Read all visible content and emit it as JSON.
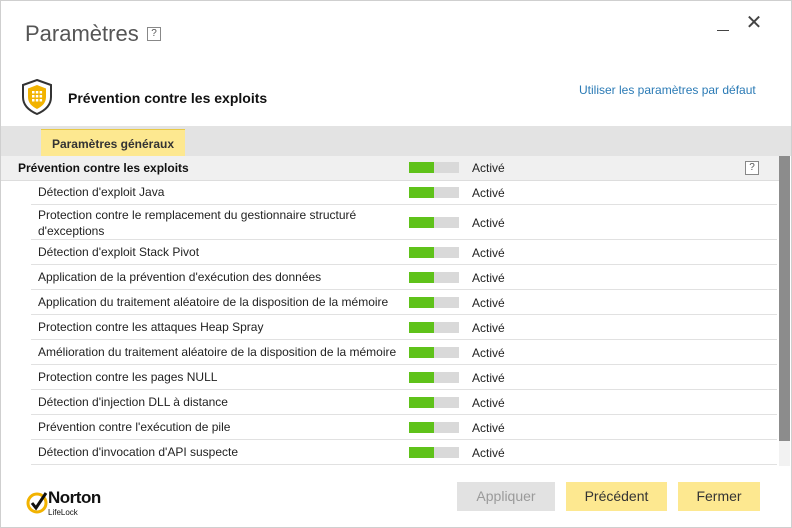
{
  "window": {
    "title": "Paramètres",
    "help": "?",
    "close_glyph": "✕"
  },
  "section": {
    "title": "Prévention contre les exploits",
    "defaults_link": "Utiliser les paramètres par défaut"
  },
  "tabs": [
    {
      "label": "Paramètres généraux",
      "active": true
    }
  ],
  "main_row": {
    "label": "Prévention contre les exploits",
    "status": "Activé",
    "toggle_level": 0.5,
    "help": "?"
  },
  "rows": [
    {
      "label": "Détection d'exploit Java",
      "status": "Activé",
      "toggle_level": 0.5
    },
    {
      "label": "Protection contre le remplacement du gestionnaire structuré d'exceptions",
      "status": "Activé",
      "toggle_level": 0.5
    },
    {
      "label": "Détection d'exploit Stack Pivot",
      "status": "Activé",
      "toggle_level": 0.5
    },
    {
      "label": "Application de la prévention d'exécution des données",
      "status": "Activé",
      "toggle_level": 0.5
    },
    {
      "label": "Application du traitement aléatoire de la disposition de la mémoire",
      "status": "Activé",
      "toggle_level": 0.5
    },
    {
      "label": "Protection contre les attaques Heap Spray",
      "status": "Activé",
      "toggle_level": 0.5
    },
    {
      "label": "Amélioration du traitement aléatoire de la disposition de la mémoire",
      "status": "Activé",
      "toggle_level": 0.5
    },
    {
      "label": "Protection contre les pages NULL",
      "status": "Activé",
      "toggle_level": 0.5
    },
    {
      "label": "Détection d'injection DLL à distance",
      "status": "Activé",
      "toggle_level": 0.5
    },
    {
      "label": "Prévention contre l'exécution de pile",
      "status": "Activé",
      "toggle_level": 0.5
    },
    {
      "label": "Détection d'invocation d'API suspecte",
      "status": "Activé",
      "toggle_level": 0.5
    }
  ],
  "footer": {
    "logo": {
      "name": "Norton",
      "sub": "LifeLock"
    },
    "apply_label": "Appliquer",
    "prev_label": "Précédent",
    "close_label": "Fermer"
  },
  "colors": {
    "accent_yellow": "#fde890",
    "toggle_on": "#5fc21a",
    "link": "#2a7ab5",
    "shield_gold": "#f2b300"
  }
}
